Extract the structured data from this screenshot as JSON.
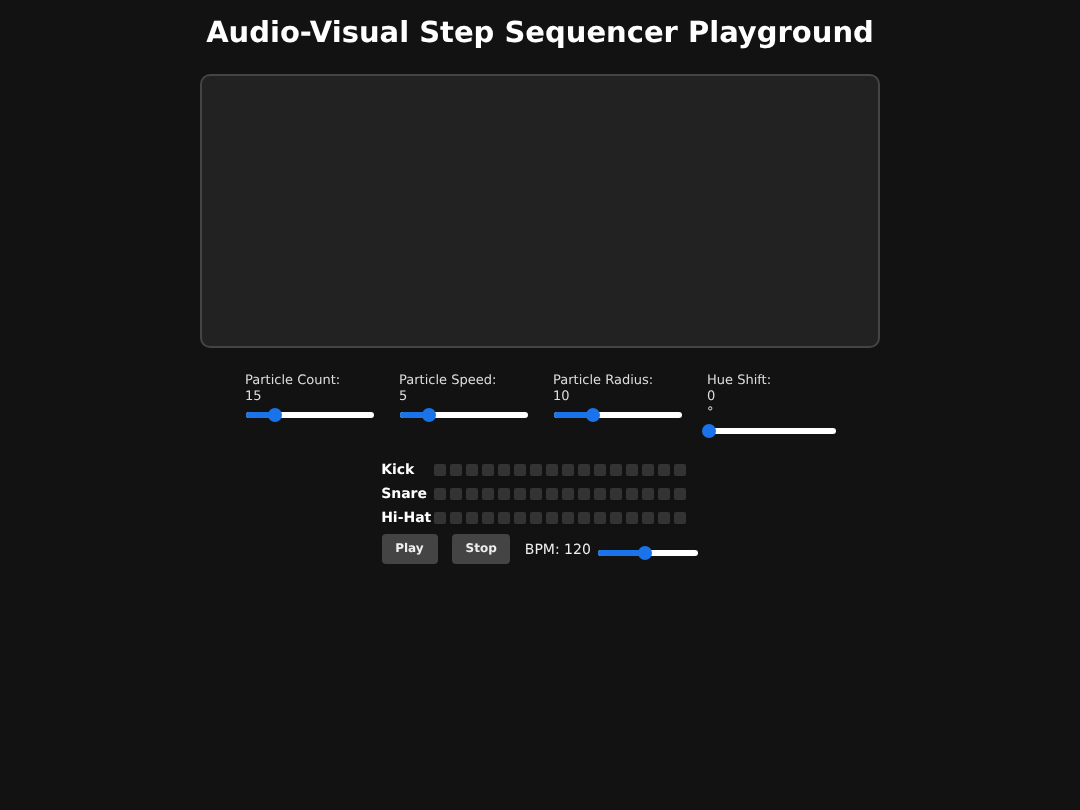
{
  "title": "Audio-Visual Step Sequencer Playground",
  "controls": [
    {
      "label": "Particle Count:",
      "value": "15",
      "level": 0.22
    },
    {
      "label": "Particle Speed:",
      "value": "5",
      "level": 0.22
    },
    {
      "label": "Particle Radius:",
      "value": "10",
      "level": 0.3
    },
    {
      "label": "Hue Shift:",
      "value": "0",
      "unit": "°",
      "level": 0
    }
  ],
  "tracks": [
    {
      "name": "Kick",
      "steps": [
        false,
        false,
        false,
        false,
        false,
        false,
        false,
        false,
        false,
        false,
        false,
        false,
        false,
        false,
        false,
        false
      ]
    },
    {
      "name": "Snare",
      "steps": [
        false,
        false,
        false,
        false,
        false,
        false,
        false,
        false,
        false,
        false,
        false,
        false,
        false,
        false,
        false,
        false
      ]
    },
    {
      "name": "Hi-Hat",
      "steps": [
        false,
        false,
        false,
        false,
        false,
        false,
        false,
        false,
        false,
        false,
        false,
        false,
        false,
        false,
        false,
        false
      ]
    }
  ],
  "buttons": [
    "Play",
    "Stop"
  ],
  "bpm": {
    "label": "BPM: 120",
    "level": 0.45
  }
}
